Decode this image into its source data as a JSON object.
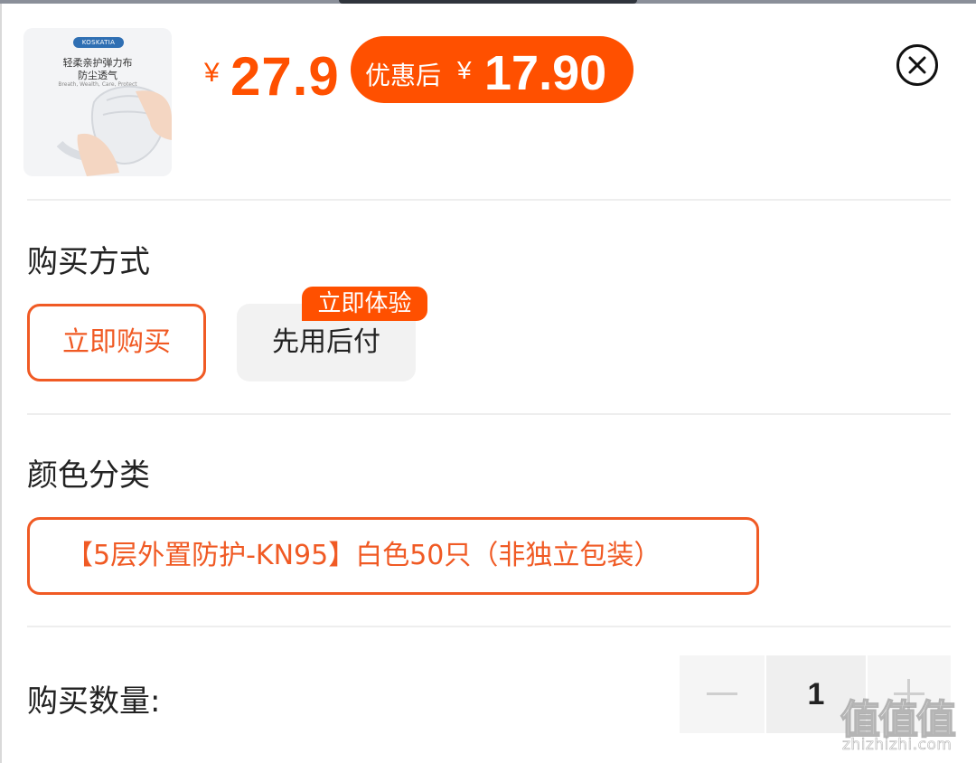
{
  "product": {
    "thumbnail": {
      "brand": "KOSKATIA",
      "line1": "轻柔亲护弹力布",
      "line2": "防尘透气",
      "line3": "Breath, Wealth, Care, Protect"
    },
    "currency_symbol": "¥",
    "price": "27.9",
    "promo": {
      "label": "优惠后",
      "currency_symbol": "¥",
      "price": "17.90"
    }
  },
  "purchase_method": {
    "title": "购买方式",
    "options": [
      {
        "label": "立即购买",
        "selected": true
      },
      {
        "label": "先用后付",
        "selected": false,
        "badge": "立即体验"
      }
    ]
  },
  "color_category": {
    "title": "颜色分类",
    "selected_variant": "【5层外置防护-KN95】白色50只（非独立包装）"
  },
  "quantity": {
    "label": "购买数量:",
    "value": "1"
  },
  "watermark": {
    "mark": "值值值",
    "url": "zhizhizhi.com"
  },
  "colors": {
    "accent": "#ff5000",
    "border_accent": "#f05a24"
  }
}
